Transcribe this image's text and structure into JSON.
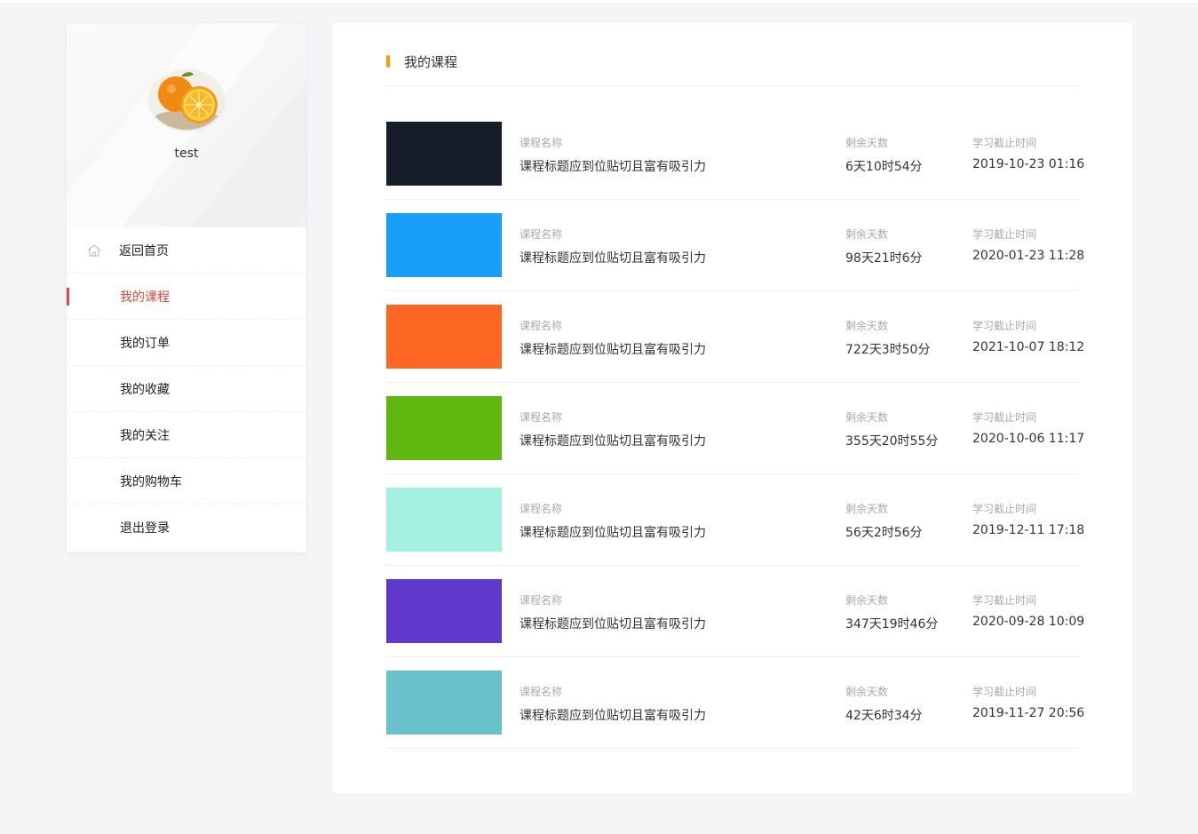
{
  "user": {
    "name": "test"
  },
  "menu": [
    {
      "label": "返回首页",
      "icon": "home-icon",
      "active": false
    },
    {
      "label": "我的课程",
      "active": true
    },
    {
      "label": "我的订单",
      "active": false
    },
    {
      "label": "我的收藏",
      "active": false
    },
    {
      "label": "我的关注",
      "active": false
    },
    {
      "label": "我的购物车",
      "active": false
    },
    {
      "label": "退出登录",
      "active": false
    }
  ],
  "main": {
    "title": "我的课程",
    "accent": "#ff9900",
    "labels": {
      "name": "课程名称",
      "remaining": "剩余天数",
      "deadline": "学习截止时间"
    },
    "courses": [
      {
        "color": "#161c28",
        "name": "课程标题应到位贴切且富有吸引力",
        "remaining": "6天10时54分",
        "deadline": "2019-10-23 01:16"
      },
      {
        "color": "#189ef7",
        "name": "课程标题应到位贴切且富有吸引力",
        "remaining": "98天21时6分",
        "deadline": "2020-01-23 11:28"
      },
      {
        "color": "#fd6623",
        "name": "课程标题应到位贴切且富有吸引力",
        "remaining": "722天3时50分",
        "deadline": "2021-10-07 18:12"
      },
      {
        "color": "#62b70e",
        "name": "课程标题应到位贴切且富有吸引力",
        "remaining": "355天20时55分",
        "deadline": "2020-10-06 11:17"
      },
      {
        "color": "#a5f1df",
        "name": "课程标题应到位贴切且富有吸引力",
        "remaining": "56天2时56分",
        "deadline": "2019-12-11 17:18"
      },
      {
        "color": "#5e39cc",
        "name": "课程标题应到位贴切且富有吸引力",
        "remaining": "347天19时46分",
        "deadline": "2020-09-28 10:09"
      },
      {
        "color": "#69c2ca",
        "name": "课程标题应到位贴切且富有吸引力",
        "remaining": "42天6时34分",
        "deadline": "2019-11-27 20:56"
      }
    ]
  },
  "colors": {
    "active": "#e8453c",
    "background": "#f5f5f8"
  }
}
